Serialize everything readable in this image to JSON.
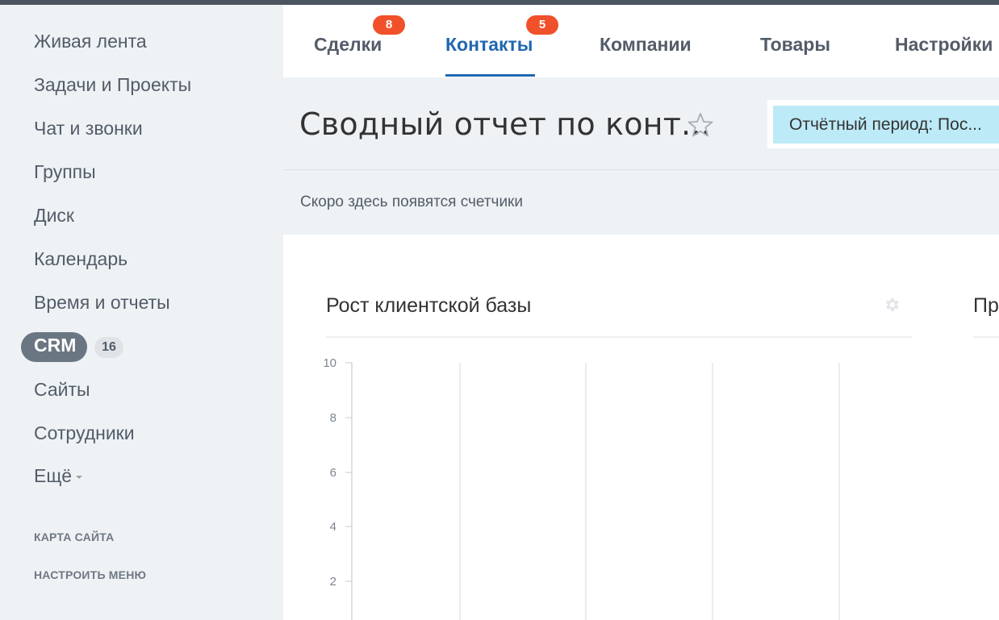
{
  "sidebar": {
    "items": [
      {
        "label": "Живая лента"
      },
      {
        "label": "Задачи и Проекты"
      },
      {
        "label": "Чат и звонки"
      },
      {
        "label": "Группы"
      },
      {
        "label": "Диск"
      },
      {
        "label": "Календарь"
      },
      {
        "label": "Время и отчеты"
      },
      {
        "label": "CRM",
        "count": "16",
        "active": true
      },
      {
        "label": "Сайты"
      },
      {
        "label": "Сотрудники"
      },
      {
        "label": "Ещё"
      }
    ],
    "sitemap": "КАРТА САЙТА",
    "customize": "НАСТРОИТЬ МЕНЮ"
  },
  "tabs": [
    {
      "label": "Сделки",
      "badge": "8"
    },
    {
      "label": "Контакты",
      "badge": "5",
      "active": true
    },
    {
      "label": "Компании"
    },
    {
      "label": "Товары"
    },
    {
      "label": "Настройки"
    }
  ],
  "page": {
    "title": "Сводный отчет по конт...",
    "period": "Отчётный период: Пос...",
    "counters_note": "Скоро здесь появятся счетчики"
  },
  "widget": {
    "title": "Рост клиентской базы",
    "second_title": "Пр"
  },
  "chart_data": {
    "type": "line",
    "title": "Рост клиентской базы",
    "y_ticks": [
      2,
      4,
      6,
      8,
      10
    ],
    "ylim": [
      0,
      10
    ],
    "vertical_gridlines": 5,
    "series": []
  },
  "colors": {
    "accent": "#2067b0",
    "badge": "#f0512a",
    "period_bg": "#bdeaf7",
    "crm_pill": "#6b7683"
  }
}
